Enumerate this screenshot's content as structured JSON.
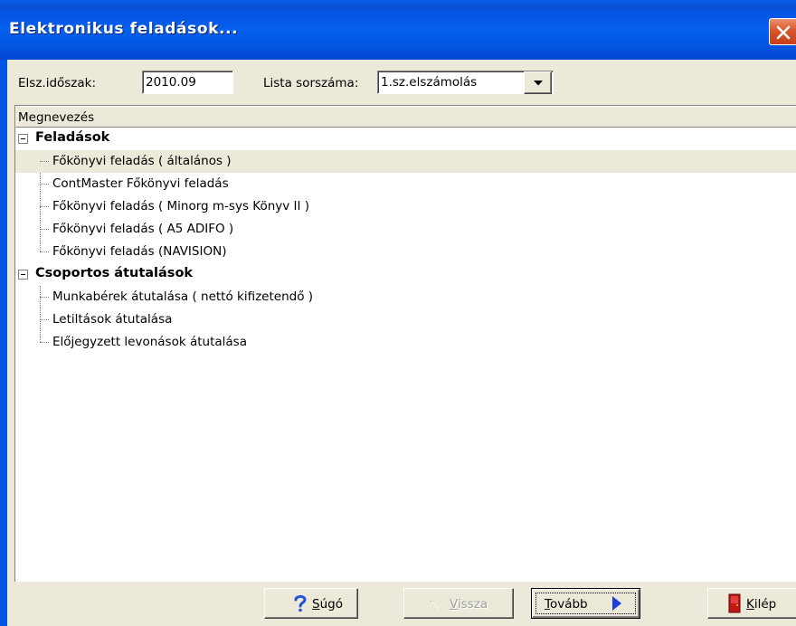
{
  "window": {
    "title": "Elektronikus feladások..."
  },
  "filters": {
    "period_label": "Elsz.időszak:",
    "period_value": "2010.09",
    "list_label": "Lista sorszáma:",
    "list_value": "1.sz.elszámolás"
  },
  "tree": {
    "column_header": "Megnevezés",
    "groups": [
      {
        "label": "Feladások",
        "items": [
          "Főkönyvi feladás ( általános )",
          "ContMaster Főkönyvi feladás",
          "Főkönyvi feladás ( Minorg m-sys Könyv II )",
          "Főkönyvi feladás ( A5 ADIFO )",
          "Főkönyvi feladás (NAVISION)"
        ]
      },
      {
        "label": "Csoportos átutalások",
        "items": [
          "Munkabérek átutalása ( nettó kifizetendő )",
          "Letiltások átutalása",
          "Előjegyzett levonások átutalása"
        ]
      }
    ],
    "selected_item": "Főkönyvi feladás ( általános )"
  },
  "buttons": {
    "help": {
      "first": "S",
      "rest": "úgó"
    },
    "back": {
      "first": "V",
      "rest": "issza"
    },
    "next": {
      "first": "T",
      "rest": "ovább"
    },
    "exit": {
      "first": "K",
      "rest": "ilép"
    }
  },
  "colors": {
    "titlebar": "#0555e5",
    "face": "#ece9d8",
    "help_icon": "#1f4fd8",
    "next_arrow": "#1a3fe0",
    "exit_door": "#c01818"
  }
}
